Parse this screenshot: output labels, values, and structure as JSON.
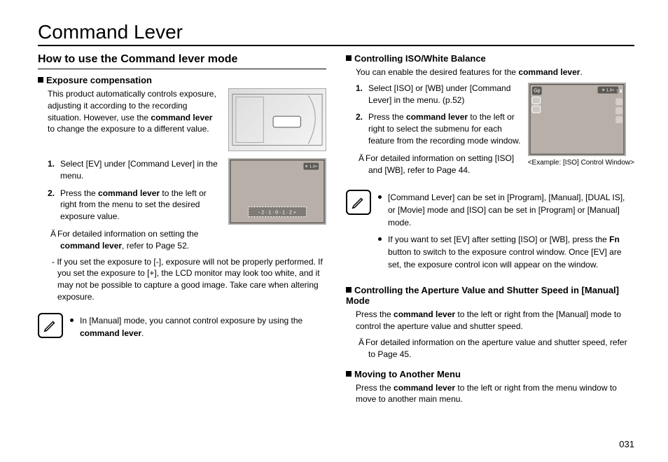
{
  "page_title": "Command Lever",
  "page_number": "031",
  "left": {
    "section_title": "How to use the Command lever mode",
    "exposure": {
      "heading": "Exposure compensation",
      "intro_pre": "This product automatically controls exposure, adjusting it according to the recording situation. However, use the ",
      "intro_bold": "command lever",
      "intro_post": " to change the exposure to a different value.",
      "step1": "Select [EV] under [Command Lever] in the menu.",
      "step2_pre": "Press the ",
      "step2_bold": "command lever",
      "step2_post": " to the left or right from the menu to set the desired exposure value.",
      "note_pre": "For detailed information on setting the ",
      "note_bold": "command lever",
      "note_post": ", refer to Page 52.",
      "warn": "- If you set the exposure to [-], exposure will not be properly performed. If you set the exposure to [+], the LCD monitor may look too white, and it may not be possible to capture a good image. Take care when altering exposure.",
      "tip_pre": "In [Manual] mode, you cannot control exposure by using the ",
      "tip_bold": "command lever",
      "tip_post": "."
    }
  },
  "right": {
    "iso": {
      "heading": "Controlling ISO/White Balance",
      "intro_pre": "You can enable the desired features for the ",
      "intro_bold": "command lever",
      "intro_post": ".",
      "step1": "Select [ISO] or [WB] under [Command Lever] in the menu. (p.52)",
      "step2_pre": "Press the ",
      "step2_bold": "command lever",
      "step2_post": " to the left or right to select the submenu for each feature from the recording mode window.",
      "note": "For detailed information on setting [ISO] and [WB], refer to Page 44.",
      "caption": "<Example: [ISO] Control Window>"
    },
    "tips": {
      "t1": "[Command Lever] can be set in [Program], [Manual], [DUAL IS], or [Movie] mode and [ISO] can be set in [Program] or [Manual] mode.",
      "t2_pre": "If you want to set [EV] after setting [ISO] or [WB], press the ",
      "t2_bold": "Fn",
      "t2_post": " button to switch to the exposure control window. Once [EV] are set, the exposure control icon will appear on the window."
    },
    "aperture": {
      "heading": "Controlling the Aperture Value and Shutter Speed in [Manual] Mode",
      "body_pre": "Press the ",
      "body_bold": "command lever",
      "body_post": " to the left or right from the [Manual] mode to control the aperture value and shutter speed.",
      "note": "For detailed information on the aperture value and shutter speed, refer to Page 45."
    },
    "moving": {
      "heading": "Moving to Another Menu",
      "body_pre": "Press the ",
      "body_bold": "command lever",
      "body_post": " to the left or right from the menu window to move to another main menu."
    }
  }
}
